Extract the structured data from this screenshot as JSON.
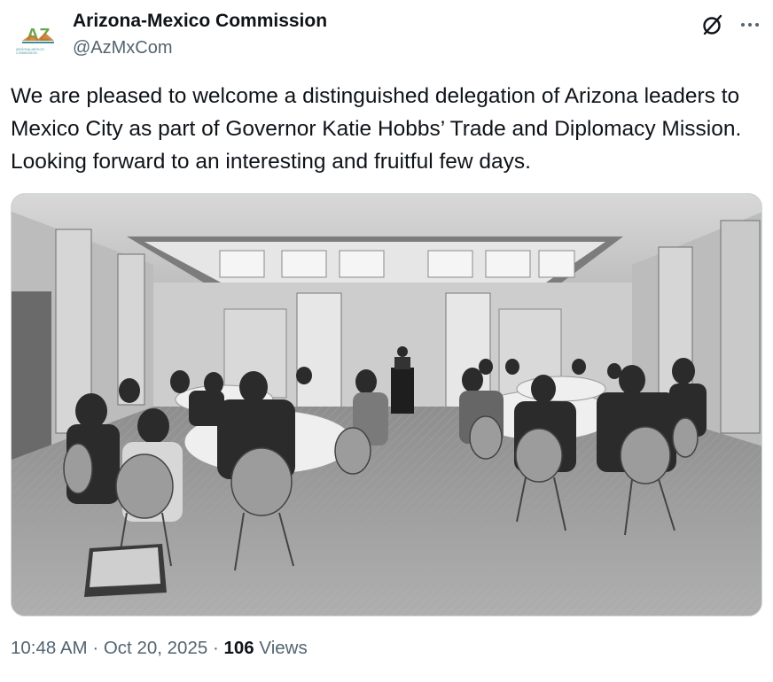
{
  "author": {
    "name": "Arizona-Mexico Commission",
    "handle": "@AzMxCom",
    "avatar_text": "AZ",
    "avatar_subtext": "ARIZONA-MEXICO COMMISSION"
  },
  "tweet": {
    "text": "We are pleased to welcome a distinguished delegation of Arizona leaders to Mexico City as part of Governor Katie Hobbs’ Trade and Diplomacy Mission. Looking forward to an interesting and fruitful few days."
  },
  "meta": {
    "time": "10:48 AM",
    "separator": "·",
    "date": "Oct 20, 2025",
    "views_count": "106",
    "views_label": "Views"
  },
  "icons": {
    "grok": "grok-icon",
    "more": "more-icon"
  },
  "colors": {
    "text_primary": "#0f1419",
    "text_secondary": "#536471",
    "logo_green": "#6aa84f",
    "logo_teal": "#3b8f9c"
  }
}
